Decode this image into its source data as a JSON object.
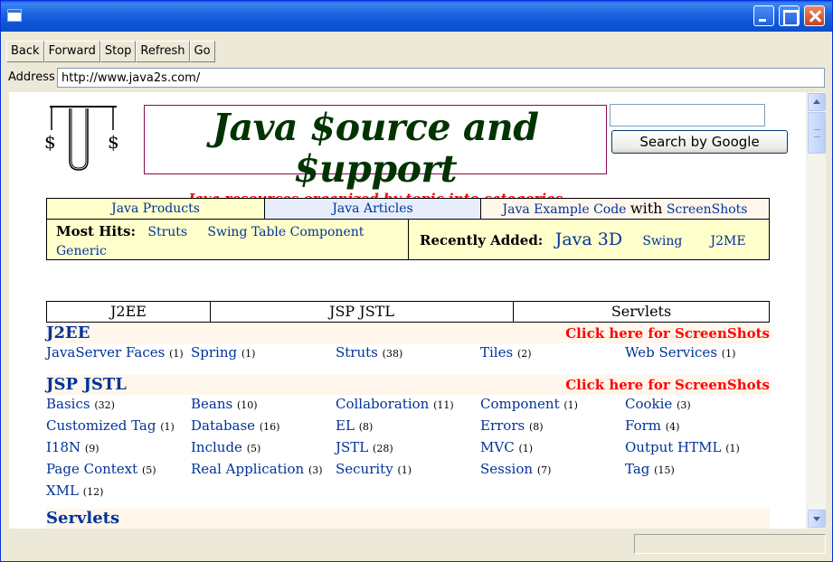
{
  "toolbar": {
    "buttons": [
      "Back",
      "Forward",
      "Stop",
      "Refresh",
      "Go"
    ]
  },
  "address": {
    "label": "Address",
    "value": "http://www.java2s.com/"
  },
  "banner": {
    "title": "Java $ource and $upport",
    "subtitle": "Java resources organized by topic into categories",
    "logo_letter": "J",
    "logo_dollar": "$"
  },
  "search": {
    "button_label": "Search by Google",
    "value": ""
  },
  "nav": {
    "products": "Java Products",
    "articles": "Java Articles",
    "example_code": "Java Example Code",
    "with": "with",
    "screenshots": "ScreenShots",
    "most_hits_label": "Most Hits:",
    "most_hits": [
      "Struts",
      "Swing Table Component",
      "Generic"
    ],
    "recently_added_label": "Recently Added:",
    "recent": [
      "Java 3D",
      "Swing",
      "J2ME"
    ]
  },
  "categories": [
    "J2EE",
    "JSP JSTL",
    "Servlets"
  ],
  "sections": [
    {
      "title": "J2EE",
      "link": "Click here for ScreenShots",
      "items": [
        {
          "name": "JavaServer Faces",
          "count": "(1)"
        },
        {
          "name": "Spring",
          "count": "(1)"
        },
        {
          "name": "Struts",
          "count": "(38)"
        },
        {
          "name": "Tiles",
          "count": "(2)"
        },
        {
          "name": "Web Services",
          "count": "(1)"
        }
      ]
    },
    {
      "title": "JSP JSTL",
      "link": "Click here for ScreenShots",
      "items": [
        {
          "name": "Basics",
          "count": "(32)"
        },
        {
          "name": "Beans",
          "count": "(10)"
        },
        {
          "name": "Collaboration",
          "count": "(11)"
        },
        {
          "name": "Component",
          "count": "(1)"
        },
        {
          "name": "Cookie",
          "count": "(3)"
        },
        {
          "name": "Customized Tag",
          "count": "(1)"
        },
        {
          "name": "Database",
          "count": "(16)"
        },
        {
          "name": "EL",
          "count": "(8)"
        },
        {
          "name": "Errors",
          "count": "(8)"
        },
        {
          "name": "Form",
          "count": "(4)"
        },
        {
          "name": "I18N",
          "count": "(9)"
        },
        {
          "name": "Include",
          "count": "(5)"
        },
        {
          "name": "JSTL",
          "count": "(28)"
        },
        {
          "name": "MVC",
          "count": "(1)"
        },
        {
          "name": "Output HTML",
          "count": "(1)"
        },
        {
          "name": "Page Context",
          "count": "(5)"
        },
        {
          "name": "Real Application",
          "count": "(3)"
        },
        {
          "name": "Security",
          "count": "(1)"
        },
        {
          "name": "Session",
          "count": "(7)"
        },
        {
          "name": "Tag",
          "count": "(15)"
        },
        {
          "name": "XML",
          "count": "(12)"
        }
      ]
    },
    {
      "title": "Servlets",
      "link": "",
      "items": []
    }
  ]
}
